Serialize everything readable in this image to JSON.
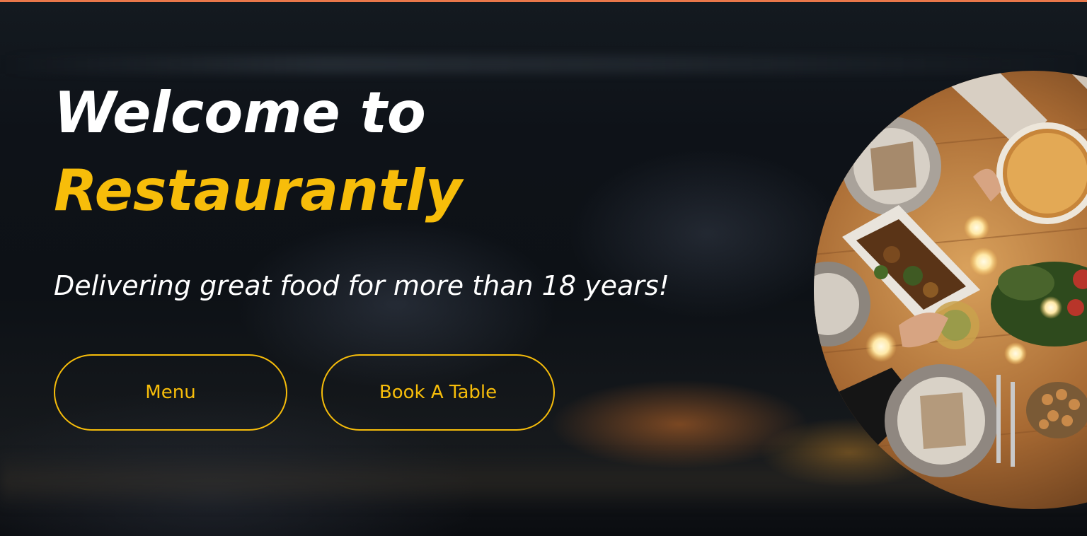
{
  "hero": {
    "title_line1": "Welcome to",
    "title_line2": "Restaurantly",
    "tagline": "Delivering great food for more than 18 years!",
    "buttons": {
      "menu_label": "Menu",
      "book_label": "Book A Table"
    },
    "image_subject": "overhead photo of a dinner table with roast dish, plates, candles and pie"
  },
  "colors": {
    "accent": "#f7bd0a",
    "heading": "#ffffff",
    "top_bar": "#e9774a",
    "background": "#0b0d12"
  }
}
